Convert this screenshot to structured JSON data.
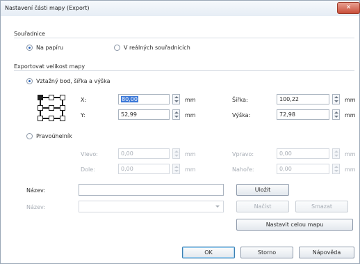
{
  "window": {
    "title": "Nastavení části mapy (Export)",
    "close_glyph": "✕"
  },
  "coords": {
    "label": "Souřadnice",
    "options": [
      "Na papíru",
      "V reálných souřadnicích"
    ],
    "selected": 0
  },
  "export_size": {
    "label": "Exportovat velikost mapy",
    "option_point": "Vztažný bod, šířka a výška",
    "x_label": "X:",
    "x_value": "80,00",
    "y_label": "Y:",
    "y_value": "52,99",
    "unit": "mm",
    "width_label": "Šířka:",
    "width_value": "100,22",
    "height_label": "Výška:",
    "height_value": "72,98",
    "option_rect": "Pravoúhelník",
    "left_label": "Vlevo:",
    "left_value": "0,00",
    "top_label": "Dole:",
    "top_value": "0,00",
    "right_label": "Vpravo:",
    "right_value": "0,00",
    "bottom_label": "Nahoře:",
    "bottom_value": "0,00"
  },
  "name_section": {
    "name_label": "Název:",
    "name_value": "",
    "combo_label": "Název:",
    "combo_value": "",
    "save_button": "Uložit",
    "load_button": "Načíst",
    "delete_button": "Smazat",
    "load_whole_button": "Nastavit celou mapu"
  },
  "footer": {
    "ok": "OK",
    "cancel": "Storno",
    "help": "Nápověda"
  }
}
